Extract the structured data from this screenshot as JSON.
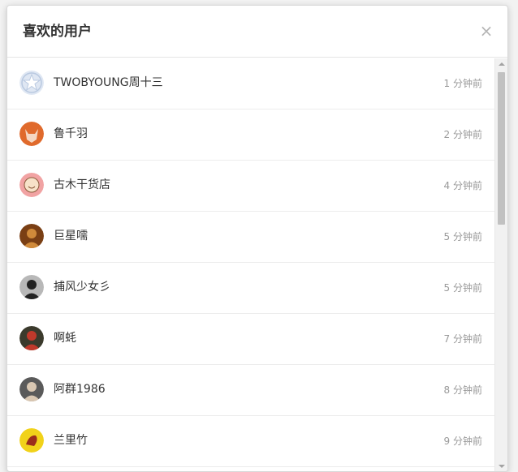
{
  "dialog": {
    "title": "喜欢的用户",
    "close_label": "×"
  },
  "users": [
    {
      "name": "TWOBYOUNG周十三",
      "time": "1 分钟前",
      "avatar_icon": "star-avatar-icon",
      "avatar_bg": "#dfe7f3",
      "avatar_fg": "#b9c9e0"
    },
    {
      "name": "鲁千羽",
      "time": "2 分钟前",
      "avatar_icon": "fox-avatar-icon",
      "avatar_bg": "#e06a2c",
      "avatar_fg": "#f5d7c2"
    },
    {
      "name": "古木干货店",
      "time": "4 分钟前",
      "avatar_icon": "cartoon-face-avatar-icon",
      "avatar_bg": "#f1a3a3",
      "avatar_fg": "#f7e2c8"
    },
    {
      "name": "巨星嚅",
      "time": "5 分钟前",
      "avatar_icon": "photo-avatar-icon",
      "avatar_bg": "#7a3f14",
      "avatar_fg": "#d08a3a"
    },
    {
      "name": "捕风少女彡",
      "time": "5 分钟前",
      "avatar_icon": "portrait-avatar-icon",
      "avatar_bg": "#b8b8b8",
      "avatar_fg": "#222222"
    },
    {
      "name": "啊蚝",
      "time": "7 分钟前",
      "avatar_icon": "portrait-avatar-icon",
      "avatar_bg": "#3b3a2c",
      "avatar_fg": "#c0392b"
    },
    {
      "name": "阿群1986",
      "time": "8 分钟前",
      "avatar_icon": "portrait-avatar-icon",
      "avatar_bg": "#5a5a5a",
      "avatar_fg": "#d9c7b2"
    },
    {
      "name": "兰里竹",
      "time": "9 分钟前",
      "avatar_icon": "cartoon-avatar-icon",
      "avatar_bg": "#f1d21a",
      "avatar_fg": "#9b2d1c"
    }
  ]
}
